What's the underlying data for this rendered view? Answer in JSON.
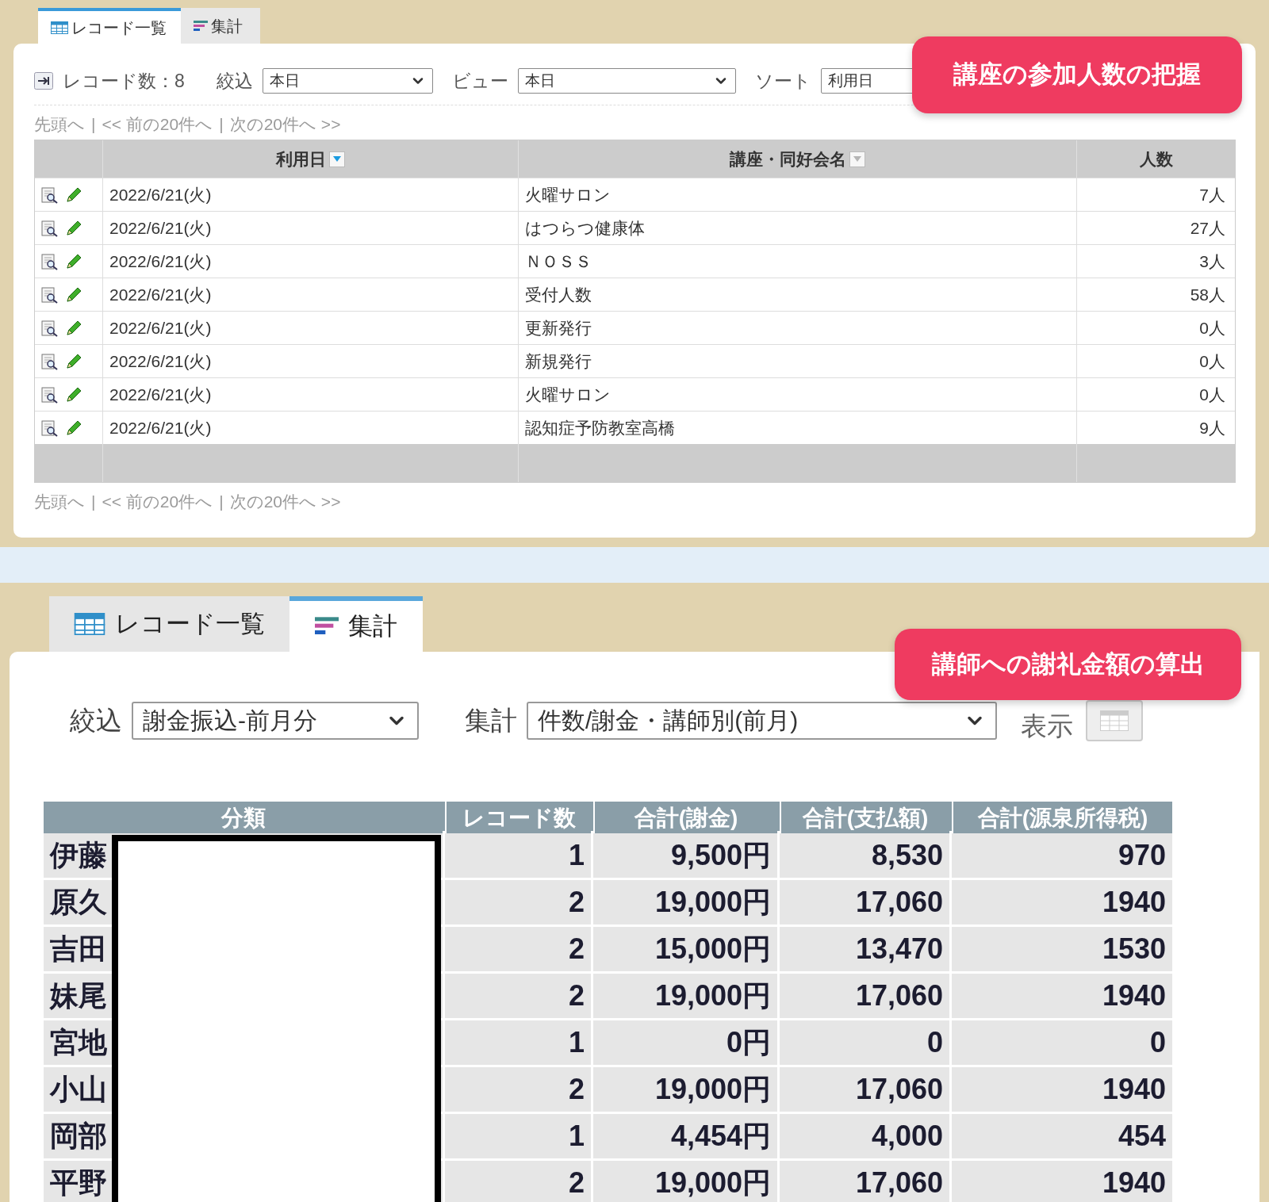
{
  "record_list_screen": {
    "tabs": [
      {
        "label": "レコード一覧",
        "kind": "table",
        "selected": true
      },
      {
        "label": "集計",
        "kind": "summary",
        "selected": false
      }
    ],
    "record_count": "レコード数：8",
    "filters": [
      {
        "label": "絞込",
        "value": "本日"
      },
      {
        "label": "ビュー",
        "value": "本日"
      },
      {
        "label": "ソート",
        "value": "利用日"
      }
    ],
    "pager_top": {
      "links": [
        "先頭へ",
        "<< 前の20件へ",
        "次の20件へ >>"
      ],
      "separator": "|"
    },
    "table": {
      "columns": [
        {
          "label": "利用日",
          "filter_active": true
        },
        {
          "label": "講座・同好会名",
          "filter_active": false
        },
        {
          "label": "人数"
        }
      ],
      "rows": [
        {
          "date": "2022/6/21(火)",
          "name": "火曜サロン",
          "count": "7人"
        },
        {
          "date": "2022/6/21(火)",
          "name": "はつらつ健康体",
          "count": "27人"
        },
        {
          "date": "2022/6/21(火)",
          "name": "ＮＯＳＳ",
          "count": "3人"
        },
        {
          "date": "2022/6/21(火)",
          "name": "受付人数",
          "count": "58人"
        },
        {
          "date": "2022/6/21(火)",
          "name": "更新発行",
          "count": "0人"
        },
        {
          "date": "2022/6/21(火)",
          "name": "新規発行",
          "count": "0人"
        },
        {
          "date": "2022/6/21(火)",
          "name": "火曜サロン",
          "count": "0人"
        },
        {
          "date": "2022/6/21(火)",
          "name": "認知症予防教室高橋",
          "count": "9人"
        }
      ]
    },
    "pager_bottom": {
      "links": [
        "先頭へ",
        "<< 前の20件へ",
        "次の20件へ >>"
      ],
      "separator": "|"
    },
    "callout": "講座の参加人数の把握"
  },
  "summary_screen": {
    "tabs": [
      {
        "label": "レコード一覧",
        "kind": "table",
        "selected": false
      },
      {
        "label": "集計",
        "kind": "summary",
        "selected": true
      }
    ],
    "filters": [
      {
        "label": "絞込",
        "value": "謝金振込-前月分"
      },
      {
        "label": "集計",
        "value": "件数/謝金・講師別(前月)"
      }
    ],
    "display_label": "表示",
    "table": {
      "columns": [
        "分類",
        "レコード数",
        "合計(謝金)",
        "合計(支払額)",
        "合計(源泉所得税)"
      ],
      "rows": [
        [
          "伊藤",
          "1",
          "9,500円",
          "8,530",
          "970"
        ],
        [
          "原久",
          "2",
          "19,000円",
          "17,060",
          "1940"
        ],
        [
          "吉田",
          "2",
          "15,000円",
          "13,470",
          "1530"
        ],
        [
          "妹尾",
          "2",
          "19,000円",
          "17,060",
          "1940"
        ],
        [
          "宮地",
          "1",
          "0円",
          "0",
          "0"
        ],
        [
          "小山",
          "2",
          "19,000円",
          "17,060",
          "1940"
        ],
        [
          "岡部",
          "1",
          "4,454円",
          "4,000",
          "454"
        ],
        [
          "平野",
          "2",
          "19,000円",
          "17,060",
          "1940"
        ]
      ]
    },
    "callout": "講師への謝礼金額の算出"
  }
}
